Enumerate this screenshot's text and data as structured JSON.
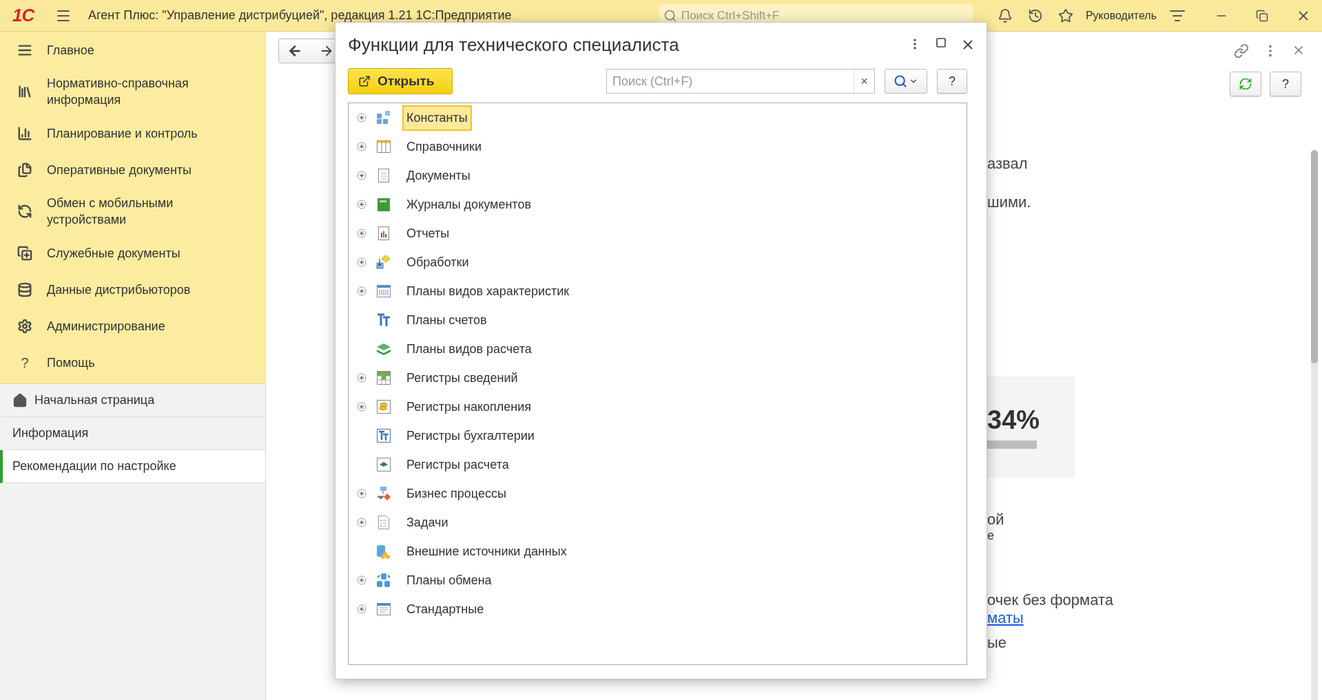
{
  "app_bar": {
    "logo": "1С",
    "title": "Агент Плюс: \"Управление дистрибуцией\", редакция 1.21 1С:Предприятие",
    "search": {
      "placeholder": "Поиск Ctrl+Shift+F"
    },
    "user": "Руководитель"
  },
  "sidebar": {
    "sections": [
      {
        "label": "Главное"
      },
      {
        "label": "Нормативно-справочная информация"
      },
      {
        "label": "Планирование и контроль"
      },
      {
        "label": "Оперативные документы"
      },
      {
        "label": "Обмен с мобильными устройствами"
      },
      {
        "label": "Служебные документы"
      },
      {
        "label": "Данные дистрибьюторов"
      },
      {
        "label": "Администрирование"
      },
      {
        "label": "Помощь",
        "icon_text": "?"
      }
    ],
    "nav": [
      {
        "label": "Начальная страница",
        "kind": "home",
        "selected": false
      },
      {
        "label": "Информация",
        "kind": "page",
        "selected": false
      },
      {
        "label": "Рекомендации по настройке",
        "kind": "page",
        "selected": true
      }
    ]
  },
  "page": {
    "help_button": "?",
    "fragments": [
      {
        "kind": "text",
        "text": "азвал"
      },
      {
        "kind": "text",
        "text": "шими."
      },
      {
        "kind": "stat",
        "text": "34%",
        "level": 1
      },
      {
        "kind": "text",
        "text": "ой"
      },
      {
        "kind": "small",
        "text": "е"
      },
      {
        "kind": "text",
        "text": "очек без формата"
      },
      {
        "kind": "link",
        "text": "маты"
      },
      {
        "kind": "text",
        "text": "ые"
      }
    ]
  },
  "dialog": {
    "title": "Функции для технического специалиста",
    "open_button": "Открыть",
    "search": {
      "placeholder": "Поиск (Ctrl+F)"
    },
    "clear_button": "×",
    "help_button": "?",
    "tree": [
      {
        "label": "Константы",
        "expandable": true,
        "selected": true
      },
      {
        "label": "Справочники",
        "expandable": true,
        "selected": false
      },
      {
        "label": "Документы",
        "expandable": true,
        "selected": false
      },
      {
        "label": "Журналы документов",
        "expandable": true,
        "selected": false
      },
      {
        "label": "Отчеты",
        "expandable": true,
        "selected": false
      },
      {
        "label": "Обработки",
        "expandable": true,
        "selected": false
      },
      {
        "label": "Планы видов характеристик",
        "expandable": true,
        "selected": false
      },
      {
        "label": "Планы счетов",
        "expandable": false,
        "selected": false
      },
      {
        "label": "Планы видов расчета",
        "expandable": false,
        "selected": false
      },
      {
        "label": "Регистры сведений",
        "expandable": true,
        "selected": false
      },
      {
        "label": "Регистры накопления",
        "expandable": true,
        "selected": false
      },
      {
        "label": "Регистры бухгалтерии",
        "expandable": false,
        "selected": false
      },
      {
        "label": "Регистры расчета",
        "expandable": false,
        "selected": false
      },
      {
        "label": "Бизнес процессы",
        "expandable": true,
        "selected": false
      },
      {
        "label": "Задачи",
        "expandable": true,
        "selected": false
      },
      {
        "label": "Внешние источники данных",
        "expandable": false,
        "selected": false
      },
      {
        "label": "Планы обмена",
        "expandable": true,
        "selected": false
      },
      {
        "label": "Стандартные",
        "expandable": true,
        "selected": false
      }
    ]
  }
}
